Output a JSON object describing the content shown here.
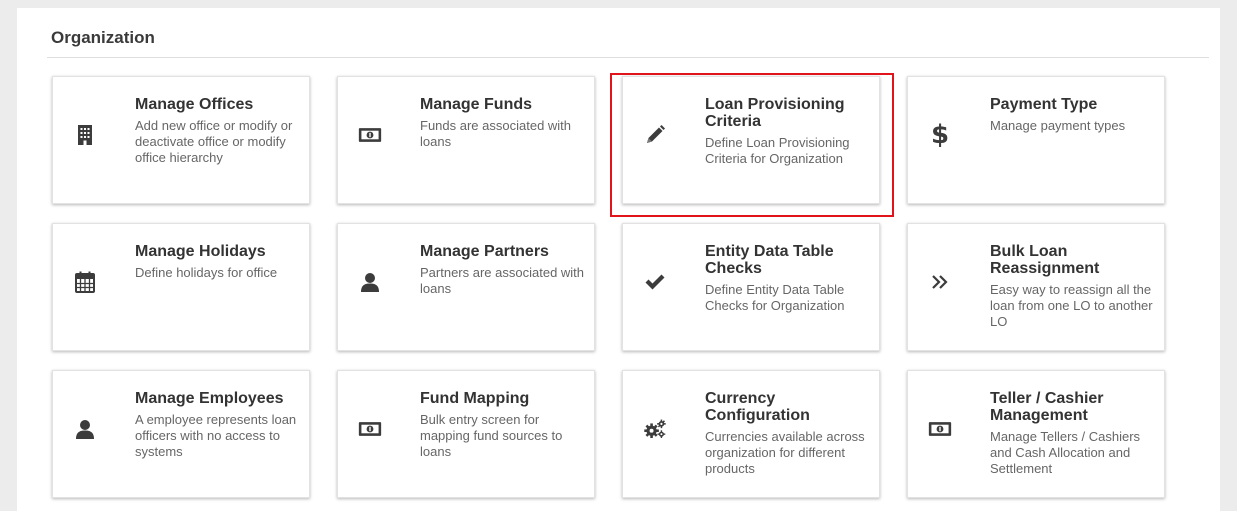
{
  "section": {
    "title": "Organization"
  },
  "highlight_color": "#e1141c",
  "cards": [
    {
      "title": "Manage Offices",
      "desc": "Add new office or modify or deactivate office or modify office hierarchy",
      "icon": "building-icon"
    },
    {
      "title": "Manage Funds",
      "desc": "Funds are associated with loans",
      "icon": "money-icon"
    },
    {
      "title": "Loan Provisioning Criteria",
      "desc": "Define Loan Provisioning Criteria for Organization",
      "icon": "pencil-icon"
    },
    {
      "title": "Payment Type",
      "desc": "Manage payment types",
      "icon": "dollar-icon",
      "glyph": "$"
    },
    {
      "title": "Manage Holidays",
      "desc": "Define holidays for office",
      "icon": "calendar-icon"
    },
    {
      "title": "Manage Partners",
      "desc": "Partners are associated with loans",
      "icon": "user-icon"
    },
    {
      "title": "Entity Data Table Checks",
      "desc": "Define Entity Data Table Checks for Organization",
      "icon": "check-icon"
    },
    {
      "title": "Bulk Loan Reassignment",
      "desc": "Easy way to reassign all the loan from one LO to another LO",
      "icon": "double-chevron-right-icon"
    },
    {
      "title": "Manage Employees",
      "desc": "A employee represents loan officers with no access to systems",
      "icon": "user-icon"
    },
    {
      "title": "Fund Mapping",
      "desc": "Bulk entry screen for mapping fund sources to loans",
      "icon": "money-icon"
    },
    {
      "title": "Currency Configuration",
      "desc": "Currencies available across organization for different products",
      "icon": "gears-icon"
    },
    {
      "title": "Teller / Cashier Management",
      "desc": "Manage Tellers / Cashiers and Cash Allocation and Settlement",
      "icon": "money-icon"
    }
  ]
}
